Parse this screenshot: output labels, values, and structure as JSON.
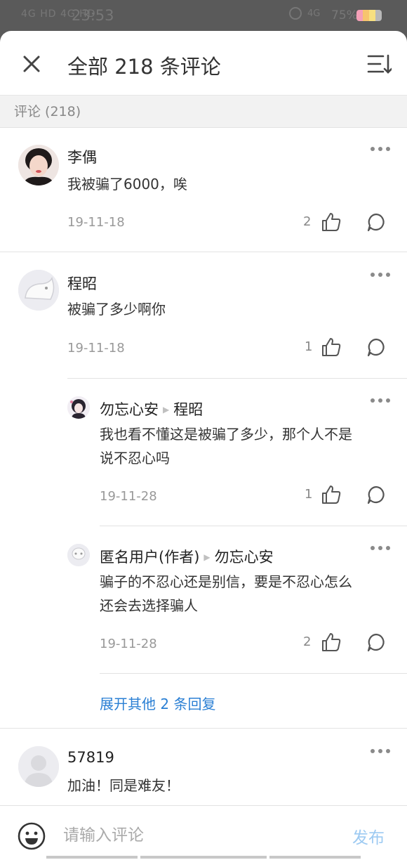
{
  "status": {
    "signal": "4G HD 4G HD",
    "time": "23:53",
    "network": "4G",
    "battery": "75%"
  },
  "header": {
    "title": "全部 218 条评论"
  },
  "section": {
    "label": "评论 (218)"
  },
  "comments": [
    {
      "name": "李偶",
      "text": "我被骗了6000，唉",
      "date": "19-11-18",
      "likes": "2"
    },
    {
      "name": "程昭",
      "text": "被骗了多少啊你",
      "date": "19-11-18",
      "likes": "1"
    },
    {
      "name": "57819",
      "text": "加油！同是难友！"
    }
  ],
  "replies": [
    {
      "name": "勿忘心安",
      "to": "程昭",
      "text_line1": "我也看不懂这是被骗了多少，那个人不是",
      "text_line2": "说不忍心吗",
      "date": "19-11-28",
      "likes": "1"
    },
    {
      "name": "匿名用户(作者)",
      "to": "勿忘心安",
      "text_line1": "骗子的不忍心还是别信，要是不忍心怎么",
      "text_line2": "还会去选择骗人",
      "date": "19-11-28",
      "likes": "2"
    }
  ],
  "expand": {
    "label": "展开其他 2 条回复"
  },
  "input": {
    "placeholder": "请输入评论",
    "send_label": "发布"
  },
  "colors": {
    "accent": "#2a7fd4",
    "send_disabled": "#9dcaf2"
  }
}
